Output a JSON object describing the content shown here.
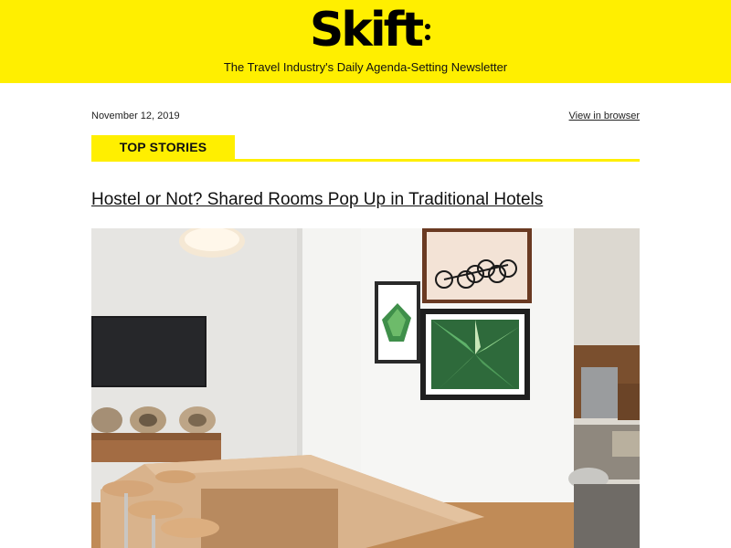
{
  "header": {
    "logo_text": "Skift",
    "tagline": "The Travel Industry's Daily Agenda-Setting Newsletter",
    "background_color": "#ffef00"
  },
  "meta": {
    "date": "November 12, 2019",
    "view_in_browser": "View in browser"
  },
  "section": {
    "label": "TOP STORIES"
  },
  "story": {
    "headline": "Hostel or Not? Shared Rooms Pop Up in Traditional Hotels",
    "image_icon": "hotel-common-room-photo"
  }
}
